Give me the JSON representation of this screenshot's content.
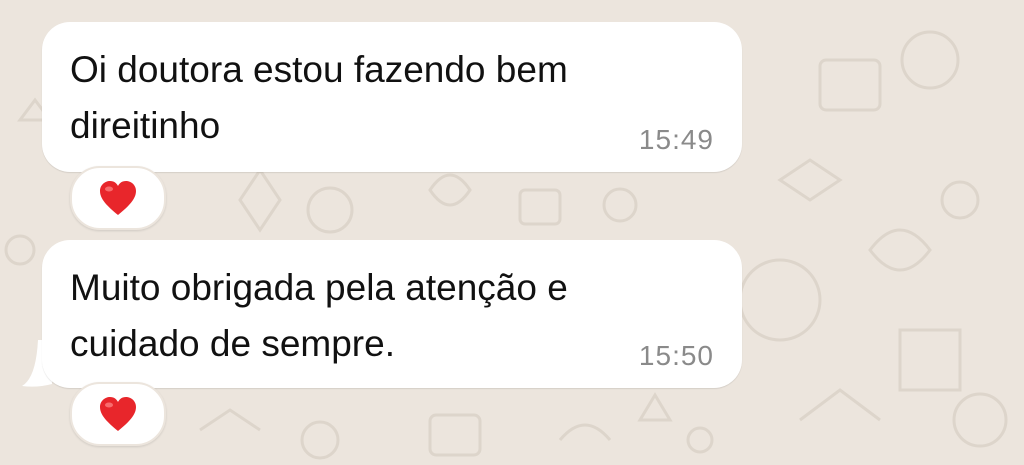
{
  "chat": {
    "messages": [
      {
        "text": "Oi doutora estou fazendo bem direitinho",
        "time": "15:49",
        "reaction": "heart-icon"
      },
      {
        "text": "Muito obrigada pela atenção e cuidado de sempre.",
        "time": "15:50",
        "reaction": "heart-icon"
      }
    ]
  },
  "colors": {
    "background": "#ece5dd",
    "bubble": "#ffffff",
    "timestamp": "#8a8a8a",
    "heart": "#e8262b"
  }
}
